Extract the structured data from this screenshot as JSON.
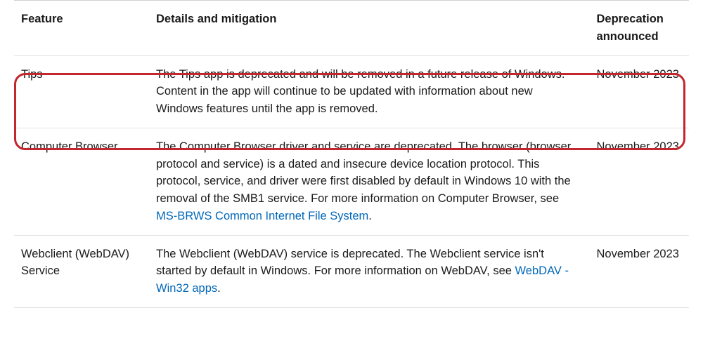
{
  "table": {
    "headers": {
      "feature": "Feature",
      "details": "Details and mitigation",
      "date": "Deprecation announced"
    },
    "rows": [
      {
        "feature": "Tips",
        "details_pre": "The Tips app is deprecated and will be removed in a future release of Windows. Content in the app will continue to be updated with information about new Windows features until the app is removed.",
        "link_text": "",
        "details_post": "",
        "date": "November 2023"
      },
      {
        "feature": "Computer Browser",
        "details_pre": "The Computer Browser driver and service are deprecated. The browser (browser protocol and service) is a dated and insecure device location protocol. This protocol, service, and driver were first disabled by default in Windows 10 with the removal of the SMB1 service. For more information on Computer Browser, see ",
        "link_text": "MS-BRWS Common Internet File System",
        "details_post": ".",
        "date": "November 2023"
      },
      {
        "feature": "Webclient (WebDAV) Service",
        "details_pre": "The Webclient (WebDAV) service is deprecated. The Webclient service isn't started by default in Windows. For more information on WebDAV, see ",
        "link_text": "WebDAV - Win32 apps",
        "details_post": ".",
        "date": "November 2023"
      }
    ]
  }
}
